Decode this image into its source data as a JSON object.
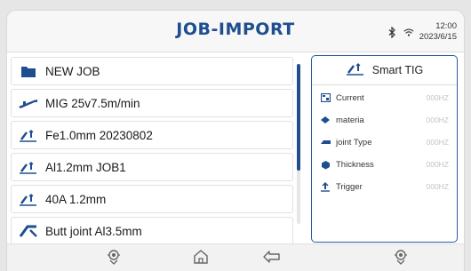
{
  "header": {
    "title": "JOB-IMPORT",
    "bluetooth_icon": "bluetooth-icon",
    "wifi_icon": "wifi-icon",
    "time": "12:00",
    "date": "2023/6/15"
  },
  "jobs": [
    {
      "label": "NEW JOB",
      "icon": "folder-icon"
    },
    {
      "label": "MIG 25v7.5m/min",
      "icon": "mig-torch-icon"
    },
    {
      "label": "Fe1.0mm 20230802",
      "icon": "tig-torch-icon"
    },
    {
      "label": "Al1.2mm JOB1",
      "icon": "tig-torch-icon"
    },
    {
      "label": "40A 1.2mm",
      "icon": "tig-torch-icon"
    },
    {
      "label": "Butt joint Al3.5mm",
      "icon": "butt-joint-icon"
    }
  ],
  "panel": {
    "title": "Smart TIG",
    "rows": [
      {
        "label": "Current",
        "value": "000HZ",
        "icon": "current-icon"
      },
      {
        "label": "materia",
        "value": "000HZ",
        "icon": "material-icon"
      },
      {
        "label": "joint Type",
        "value": "000HZ",
        "icon": "joint-type-icon"
      },
      {
        "label": "Thickness",
        "value": "000HZ",
        "icon": "thickness-icon"
      },
      {
        "label": "Trigger",
        "value": "000HZ",
        "icon": "trigger-icon"
      }
    ]
  },
  "footer": {
    "buttons": [
      "settings-left-icon",
      "home-icon",
      "back-icon",
      "settings-right-icon"
    ]
  },
  "colors": {
    "accent": "#1f4e8f",
    "border": "#2c5aa0"
  }
}
